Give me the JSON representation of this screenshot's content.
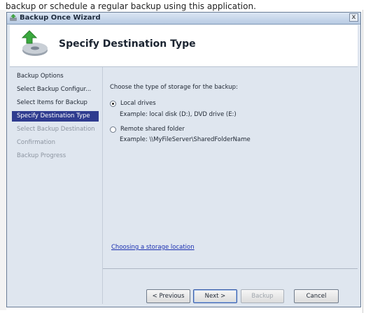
{
  "background": {
    "text": "backup or schedule a regular backup using this application."
  },
  "window": {
    "title": "Backup Once Wizard",
    "close_label": "x"
  },
  "header": {
    "title": "Specify Destination Type"
  },
  "nav": {
    "items": [
      {
        "label": "Backup Options",
        "state": "normal"
      },
      {
        "label": "Select Backup Configur...",
        "state": "normal"
      },
      {
        "label": "Select Items for Backup",
        "state": "normal"
      },
      {
        "label": "Specify Destination Type",
        "state": "active"
      },
      {
        "label": "Select Backup Destination",
        "state": "disabled"
      },
      {
        "label": "Confirmation",
        "state": "disabled"
      },
      {
        "label": "Backup Progress",
        "state": "disabled"
      }
    ]
  },
  "content": {
    "prompt": "Choose the type of storage for the backup:",
    "options": [
      {
        "label": "Local drives",
        "example": "Example: local disk (D:), DVD drive (E:)",
        "checked": true
      },
      {
        "label": "Remote shared folder",
        "example": "Example: \\\\MyFileServer\\SharedFolderName",
        "checked": false
      }
    ],
    "help_link": "Choosing a storage location"
  },
  "buttons": {
    "previous": "< Previous",
    "next": "Next >",
    "backup": "Backup",
    "cancel": "Cancel"
  },
  "colors": {
    "accent_nav_active": "#2f3c8f",
    "link": "#1a2fb0",
    "window_bg": "#dfe6ef"
  }
}
